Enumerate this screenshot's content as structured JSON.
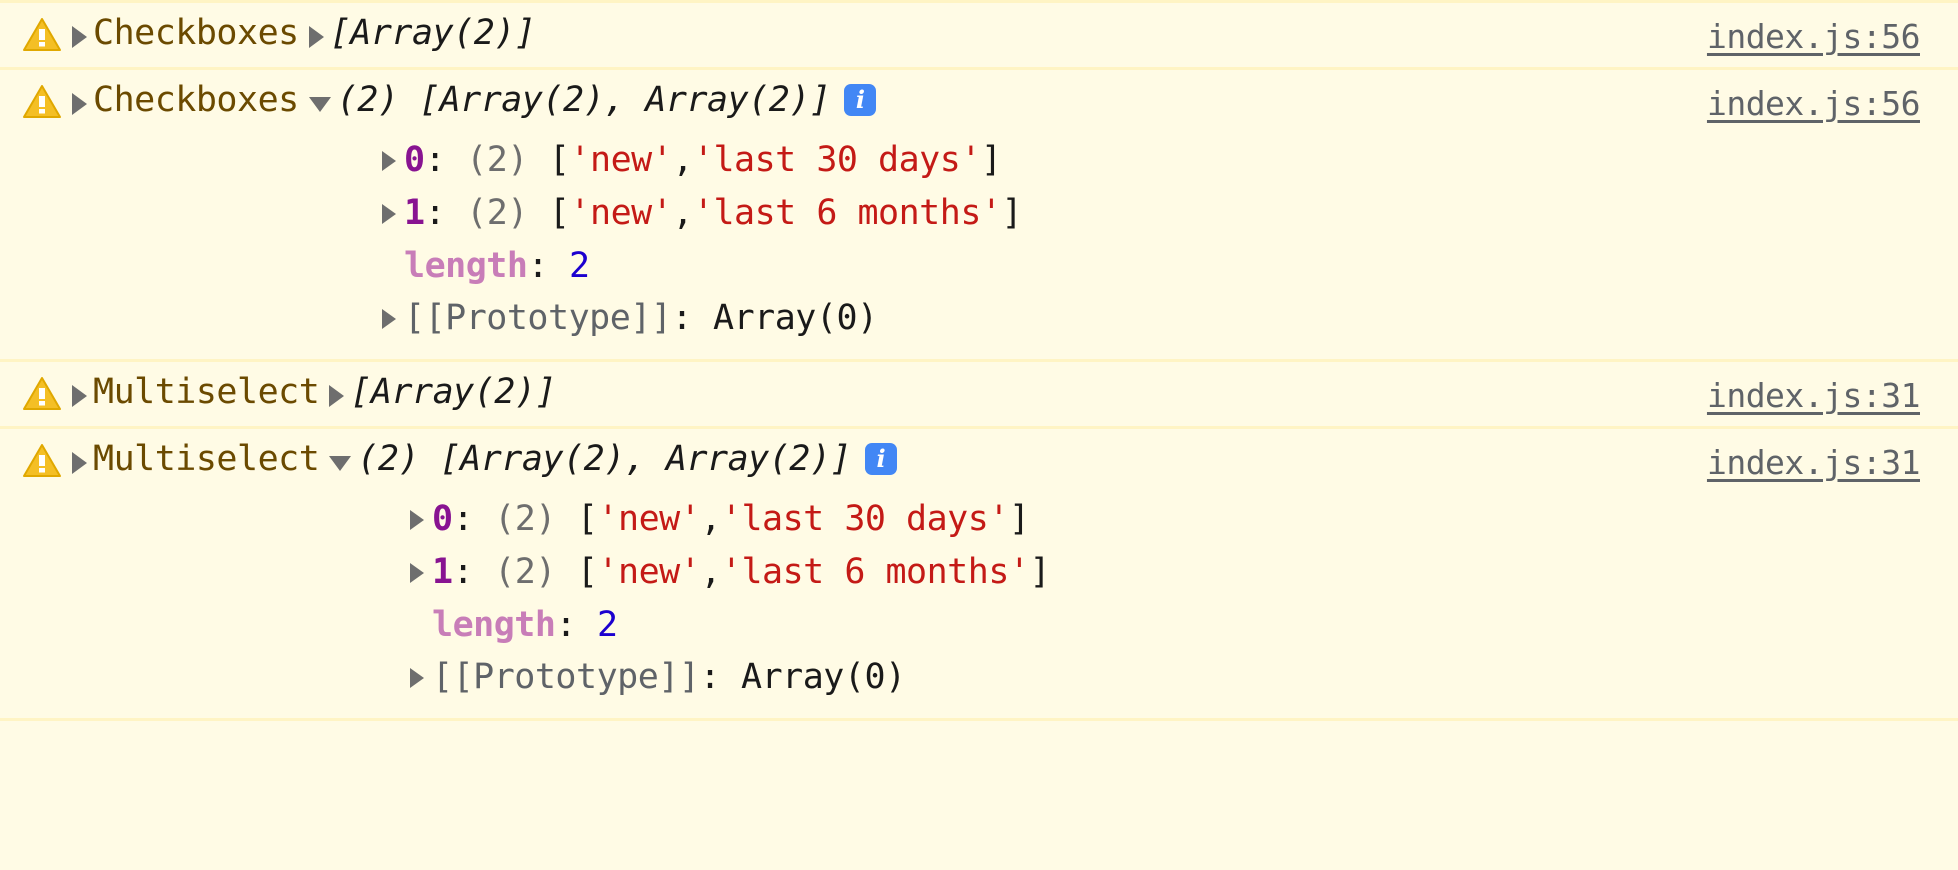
{
  "theme": {
    "background": "#fffbe5",
    "divider": "#fff4c4",
    "warning_icon_color": "#f2b500",
    "label_color": "#6b4a00",
    "source_link_color": "#5f6368",
    "string_color": "#c41a16",
    "number_color": "#1c00cf",
    "index_key_color": "#881391",
    "length_key_color": "#c87db8",
    "count_color": "#6e6e6e",
    "info_badge_color": "#4287f5"
  },
  "messages": [
    {
      "icon": "warning-icon",
      "label": "Checkboxes",
      "collapsed_preview": "[Array(2)]",
      "expanded": false,
      "has_info_badge": false,
      "source": "index.js:56",
      "disclosure_label": "collapsed",
      "disclosure_preview": "collapsed"
    },
    {
      "icon": "warning-icon",
      "label": "Checkboxes",
      "expanded_preview": "(2) [Array(2), Array(2)]",
      "expanded": true,
      "has_info_badge": true,
      "info_badge_glyph": "i",
      "source": "index.js:56",
      "disclosure_label": "collapsed",
      "disclosure_preview": "expanded",
      "children": [
        {
          "disclosure": "collapsed",
          "key": "0",
          "colon": ":",
          "count": "(2)",
          "open_bracket": "[",
          "values": [
            "'new'",
            "'last 30 days'"
          ],
          "separator": ", ",
          "close_bracket": "]"
        },
        {
          "disclosure": "collapsed",
          "key": "1",
          "colon": ":",
          "count": "(2)",
          "open_bracket": "[",
          "values": [
            "'new'",
            "'last 6 months'"
          ],
          "separator": ", ",
          "close_bracket": "]"
        },
        {
          "disclosure": "none",
          "key": "length",
          "colon": ":",
          "number": "2"
        },
        {
          "disclosure": "collapsed",
          "key": "[[Prototype]]",
          "colon": ":",
          "value": "Array(0)"
        }
      ]
    },
    {
      "icon": "warning-icon",
      "label": "Multiselect",
      "collapsed_preview": "[Array(2)]",
      "expanded": false,
      "has_info_badge": false,
      "source": "index.js:31",
      "disclosure_label": "collapsed",
      "disclosure_preview": "collapsed"
    },
    {
      "icon": "warning-icon",
      "label": "Multiselect",
      "expanded_preview": "(2) [Array(2), Array(2)]",
      "expanded": true,
      "has_info_badge": true,
      "info_badge_glyph": "i",
      "source": "index.js:31",
      "disclosure_label": "collapsed",
      "disclosure_preview": "expanded",
      "children": [
        {
          "disclosure": "collapsed",
          "key": "0",
          "colon": ":",
          "count": "(2)",
          "open_bracket": "[",
          "values": [
            "'new'",
            "'last 30 days'"
          ],
          "separator": ", ",
          "close_bracket": "]"
        },
        {
          "disclosure": "collapsed",
          "key": "1",
          "colon": ":",
          "count": "(2)",
          "open_bracket": "[",
          "values": [
            "'new'",
            "'last 6 months'"
          ],
          "separator": ", ",
          "close_bracket": "]"
        },
        {
          "disclosure": "none",
          "key": "length",
          "colon": ":",
          "number": "2"
        },
        {
          "disclosure": "collapsed",
          "key": "[[Prototype]]",
          "colon": ":",
          "value": "Array(0)"
        }
      ]
    }
  ]
}
